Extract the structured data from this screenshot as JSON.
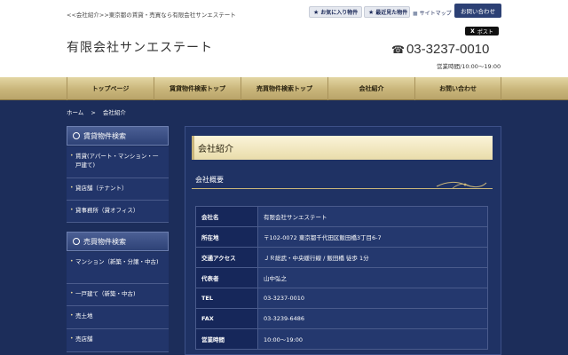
{
  "header": {
    "tagline": "<<会社紹介>>東京都の賃貸・売買なら有限会社サンエステート",
    "logo": "有限会社サンエステート",
    "favorites_label": "お気に入り物件",
    "recent_label": "最近見た物件",
    "sitemap_label": "サイトマップ",
    "contact_label": "お問い合わせ",
    "post_label": "ポスト",
    "phone": "03-3237-0010",
    "hours": "営業時間/10:00～19:00"
  },
  "nav": [
    {
      "label": "トップページ"
    },
    {
      "label": "賃貸物件検索トップ"
    },
    {
      "label": "売買物件検索トップ"
    },
    {
      "label": "会社紹介"
    },
    {
      "label": "お問い合わせ"
    }
  ],
  "breadcrumb": {
    "home": "ホーム",
    "sep": ">",
    "current": "会社紹介"
  },
  "sidebar": {
    "rent_title": "賃貸物件検索",
    "rent_items": [
      {
        "label": "賃貸(アパート・マンション・一戸建て)"
      },
      {
        "label": "貸店舗（テナント）"
      },
      {
        "label": "貸事務所（貸オフィス）"
      }
    ],
    "sale_title": "売買物件検索",
    "sale_items": [
      {
        "label": "マンション（新築・分譲・中古)"
      },
      {
        "label": "一戸建て（新築・中古)"
      },
      {
        "label": "売土地"
      },
      {
        "label": "売店舗"
      }
    ]
  },
  "main": {
    "page_title": "会社紹介",
    "section_title": "会社概要",
    "rows": [
      {
        "label": "会社名",
        "value": "有限会社サンエステート"
      },
      {
        "label": "所在地",
        "value": "〒102-0072 東京都千代田区飯田橋3丁目6-7"
      },
      {
        "label": "交通アクセス",
        "value": "ＪＲ総武・中央緩行線 / 飯田橋 徒歩 1分"
      },
      {
        "label": "代表者",
        "value": "山中弘之"
      },
      {
        "label": "TEL",
        "value": "03-3237-0010"
      },
      {
        "label": "FAX",
        "value": "03-3239-6486"
      },
      {
        "label": "営業時間",
        "value": "10:00～19:00"
      }
    ]
  }
}
